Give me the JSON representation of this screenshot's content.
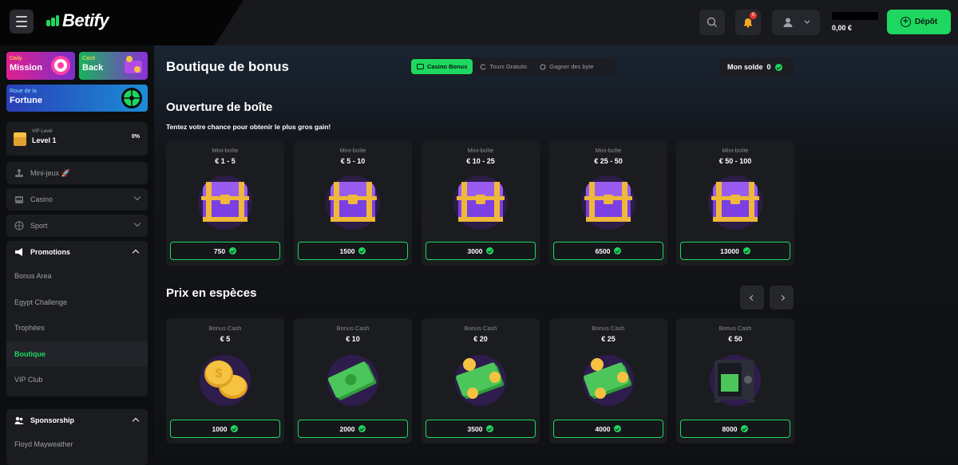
{
  "header": {
    "logo": "Betify",
    "balance": "0,00 €",
    "deposit_label": "Dépôt",
    "notification_count": "0"
  },
  "sidebar": {
    "promos": [
      {
        "line1": "Daily",
        "line2": "Mission"
      },
      {
        "line1": "Cash",
        "line2": "Back"
      },
      {
        "line1": "Roue de la",
        "line2": "Fortune"
      }
    ],
    "vip": {
      "label": "VIP Level",
      "level": "Level 1",
      "percent": "0%"
    },
    "items": [
      {
        "label": "Mini-jeux 🚀"
      },
      {
        "label": "Casino"
      },
      {
        "label": "Sport"
      }
    ],
    "promotions": {
      "label": "Promotions",
      "items": [
        "Bonus Area",
        "Egypt Challenge",
        "Trophées",
        "Boutique",
        "VIP Club"
      ]
    },
    "sponsorship": {
      "label": "Sponsorship",
      "items": [
        "Floyd Mayweather"
      ]
    }
  },
  "main": {
    "title": "Boutique de bonus",
    "tabs": [
      {
        "label": "Casino Bonus",
        "active": true
      },
      {
        "label": "Tours Gratuits",
        "active": false
      },
      {
        "label": "Gagner des byte",
        "active": false
      }
    ],
    "solde_label": "Mon solde",
    "solde_value": "0",
    "boxes": {
      "title": "Ouverture de boîte",
      "subtitle": "Tentez votre chance pour obtenir le plus gros gain!",
      "cards": [
        {
          "type": "Mini-boîte",
          "range": "€ 1 - 5",
          "price": "750"
        },
        {
          "type": "Mini-boîte",
          "range": "€ 5 - 10",
          "price": "1500"
        },
        {
          "type": "Mini-boîte",
          "range": "€ 10 - 25",
          "price": "3000"
        },
        {
          "type": "Mini-boîte",
          "range": "€ 25 - 50",
          "price": "6500"
        },
        {
          "type": "Mini-boîte",
          "range": "€ 50 - 100",
          "price": "13000"
        }
      ]
    },
    "cash": {
      "title": "Prix en espèces",
      "cards": [
        {
          "type": "Bonus Cash",
          "range": "€ 5",
          "price": "1000",
          "art": "coins"
        },
        {
          "type": "Bonus Cash",
          "range": "€ 10",
          "price": "2000",
          "art": "bills"
        },
        {
          "type": "Bonus Cash",
          "range": "€ 20",
          "price": "3500",
          "art": "bills-coins"
        },
        {
          "type": "Bonus Cash",
          "range": "€ 25",
          "price": "4000",
          "art": "bills-coins"
        },
        {
          "type": "Bonus Cash",
          "range": "€ 50",
          "price": "8000",
          "art": "safe"
        }
      ]
    }
  },
  "colors": {
    "accent": "#1ed760",
    "chest_purple": "#7b3fe4",
    "chest_gold": "#f0b83a"
  }
}
